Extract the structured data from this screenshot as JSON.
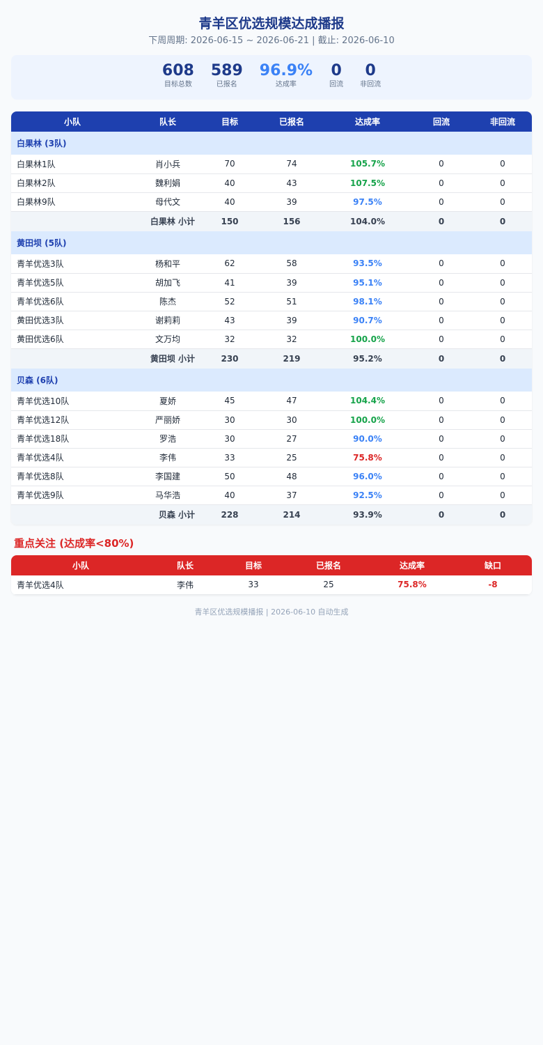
{
  "header": {
    "title": "青羊区优选规模达成播报",
    "subtitle": "下周周期: 2026-06-15 ~ 2026-06-21 | 截止: 2026-06-10"
  },
  "stats": [
    {
      "value": "608",
      "label": "目标总数",
      "color": "#1e3a8a"
    },
    {
      "value": "589",
      "label": "已报名",
      "color": "#1e3a8a"
    },
    {
      "value": "96.9%",
      "label": "达成率",
      "color": "#3b82f6"
    },
    {
      "value": "0",
      "label": "回流",
      "color": "#1e3a8a"
    },
    {
      "value": "0",
      "label": "非回流",
      "color": "#1e3a8a"
    }
  ],
  "main_table": {
    "headers": [
      "小队",
      "队长",
      "目标",
      "已报名",
      "达成率",
      "回流",
      "非回流"
    ],
    "groups": [
      {
        "title": "白果林 (3队)",
        "rows": [
          [
            "白果林1队",
            "肖小兵",
            "70",
            "74",
            "105.7%",
            "0",
            "0",
            "green"
          ],
          [
            "白果林2队",
            "魏利娟",
            "40",
            "43",
            "107.5%",
            "0",
            "0",
            "green"
          ],
          [
            "白果林9队",
            "母代文",
            "40",
            "39",
            "97.5%",
            "0",
            "0",
            "blue"
          ]
        ],
        "subtotal": [
          "白果林 小计",
          "150",
          "156",
          "104.0%",
          "0",
          "0"
        ]
      },
      {
        "title": "黄田坝 (5队)",
        "rows": [
          [
            "青羊优选3队",
            "杨和平",
            "62",
            "58",
            "93.5%",
            "0",
            "0",
            "blue"
          ],
          [
            "青羊优选5队",
            "胡加飞",
            "41",
            "39",
            "95.1%",
            "0",
            "0",
            "blue"
          ],
          [
            "青羊优选6队",
            "陈杰",
            "52",
            "51",
            "98.1%",
            "0",
            "0",
            "blue"
          ],
          [
            "黄田优选3队",
            "谢莉莉",
            "43",
            "39",
            "90.7%",
            "0",
            "0",
            "blue"
          ],
          [
            "黄田优选6队",
            "文万均",
            "32",
            "32",
            "100.0%",
            "0",
            "0",
            "green"
          ]
        ],
        "subtotal": [
          "黄田坝 小计",
          "230",
          "219",
          "95.2%",
          "0",
          "0"
        ]
      },
      {
        "title": "贝森 (6队)",
        "rows": [
          [
            "青羊优选10队",
            "夏娇",
            "45",
            "47",
            "104.4%",
            "0",
            "0",
            "green"
          ],
          [
            "青羊优选12队",
            "严丽娇",
            "30",
            "30",
            "100.0%",
            "0",
            "0",
            "green"
          ],
          [
            "青羊优选18队",
            "罗浩",
            "30",
            "27",
            "90.0%",
            "0",
            "0",
            "blue"
          ],
          [
            "青羊优选4队",
            "李伟",
            "33",
            "25",
            "75.8%",
            "0",
            "0",
            "red"
          ],
          [
            "青羊优选8队",
            "李国建",
            "50",
            "48",
            "96.0%",
            "0",
            "0",
            "blue"
          ],
          [
            "青羊优选9队",
            "马华浩",
            "40",
            "37",
            "92.5%",
            "0",
            "0",
            "blue"
          ]
        ],
        "subtotal": [
          "贝森 小计",
          "228",
          "214",
          "93.9%",
          "0",
          "0"
        ]
      }
    ]
  },
  "focus": {
    "title": "重点关注 (达成率<80%)",
    "headers": [
      "小队",
      "队长",
      "目标",
      "已报名",
      "达成率",
      "缺口"
    ],
    "rows": [
      [
        "青羊优选4队",
        "李伟",
        "33",
        "25",
        "75.8%",
        "-8"
      ]
    ]
  },
  "footer": "青羊区优选规模播报 | 2026-06-10 自动生成",
  "colors": {
    "primary": "#1e40af",
    "alert": "#dc2626",
    "good": "#16a34a",
    "mid": "#3b82f6"
  }
}
